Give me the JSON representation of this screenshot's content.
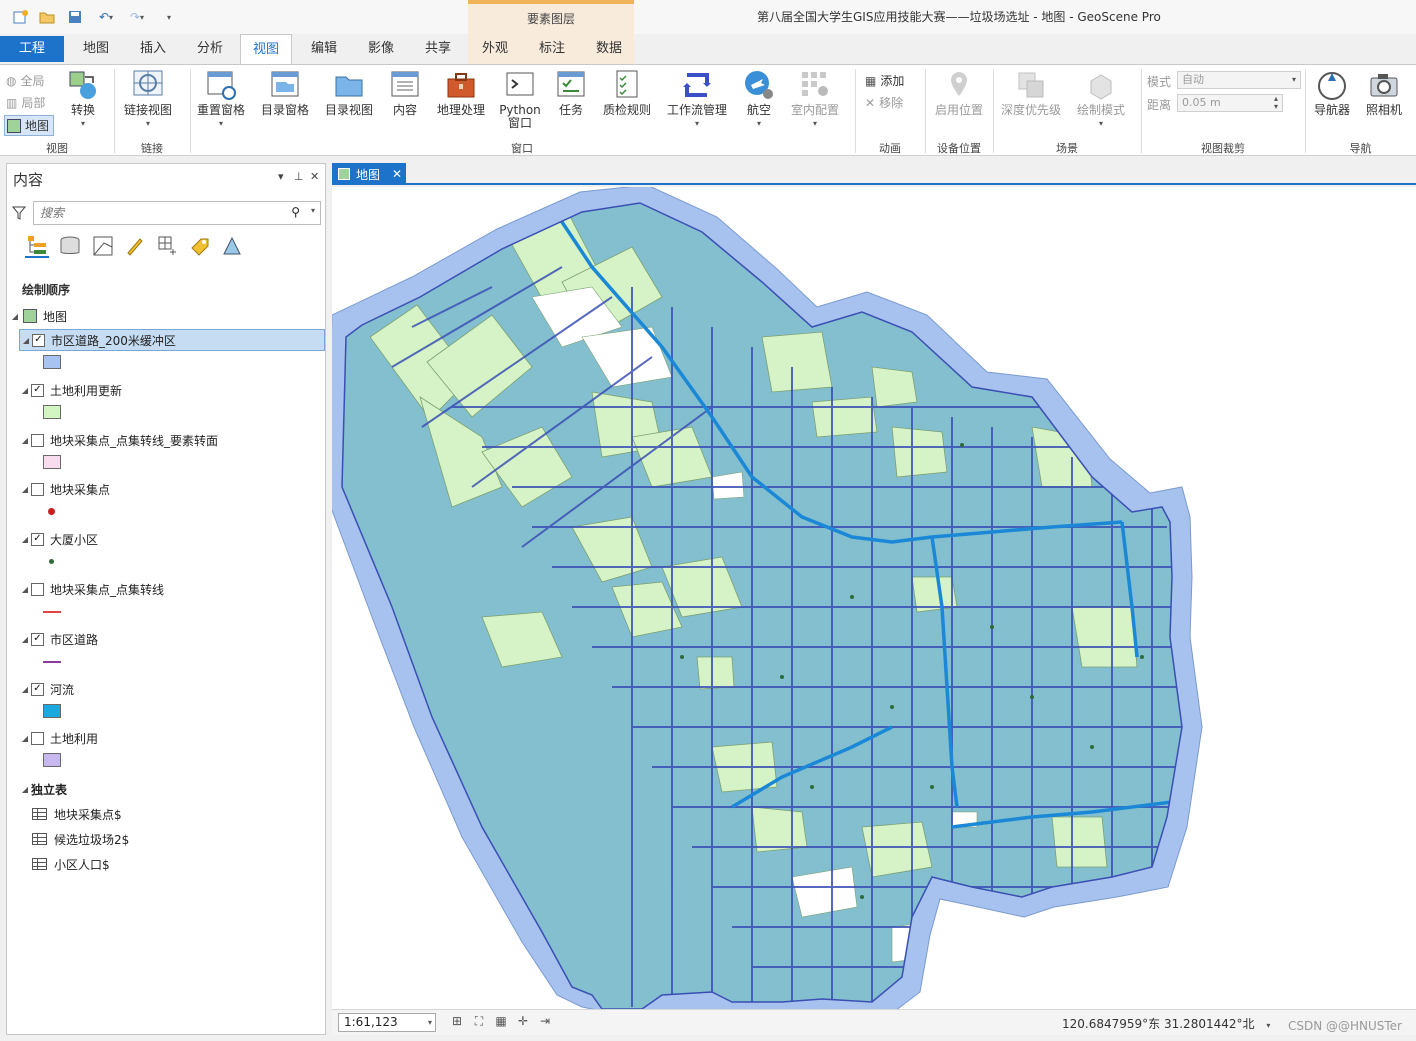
{
  "app": {
    "title": "第八届全国大学生GIS应用技能大赛——垃圾场选址 - 地图 - GeoScene Pro",
    "contextual_group": "要素图层"
  },
  "tabs": [
    {
      "label": "工程"
    },
    {
      "label": "地图"
    },
    {
      "label": "插入"
    },
    {
      "label": "分析"
    },
    {
      "label": "视图"
    },
    {
      "label": "编辑"
    },
    {
      "label": "影像"
    },
    {
      "label": "共享"
    },
    {
      "label": "外观"
    },
    {
      "label": "标注"
    },
    {
      "label": "数据"
    }
  ],
  "ribbon": {
    "view_small": [
      "全局",
      "局部",
      "地图"
    ],
    "convert": "转换",
    "link_views": "链接视图",
    "reset_panes": "重置窗格",
    "catalog_pane": "目录窗格",
    "catalog_view": "目录视图",
    "contents": "内容",
    "geoprocessing": "地理处理",
    "python": "Python\n窗口",
    "tasks": "任务",
    "data_reviewer": "质检规则",
    "workflow": "工作流管理",
    "aviation": "航空",
    "indoors": "室内配置",
    "add": "添加",
    "remove": "移除",
    "device_location": "启用位置",
    "depth_priority": "深度优先级",
    "draw_mode": "绘制模式",
    "mode_label": "模式",
    "mode_value": "自动",
    "distance_label": "距离",
    "distance_value": "0.05 m",
    "navigator": "导航器",
    "camera": "照相机",
    "groups": {
      "view": "视图",
      "link": "链接",
      "windows": "窗口",
      "animation": "动画",
      "device_location": "设备位置",
      "scene": "场景",
      "view_clipping": "视图裁剪",
      "navigate": "导航"
    }
  },
  "contents": {
    "title": "内容",
    "search_placeholder": "搜索",
    "drawing_order": "绘制顺序",
    "map_name": "地图",
    "layers": [
      {
        "name": "市区道路_200米缓冲区",
        "checked": true,
        "swatch": "#a9c3f0",
        "swatch_type": "fill",
        "selected": true
      },
      {
        "name": "土地利用更新",
        "checked": true,
        "swatch": "#d3f5c4",
        "swatch_type": "fill"
      },
      {
        "name": "地块采集点_点集转线_要素转面",
        "checked": false,
        "swatch": "#fadcef",
        "swatch_type": "fill"
      },
      {
        "name": "地块采集点",
        "checked": false,
        "swatch": "#c81e1e",
        "swatch_type": "point"
      },
      {
        "name": "大厦小区",
        "checked": true,
        "swatch": "#2e6b3a",
        "swatch_type": "point-small"
      },
      {
        "name": "地块采集点_点集转线",
        "checked": false,
        "swatch": "#e04444",
        "swatch_type": "line"
      },
      {
        "name": "市区道路",
        "checked": true,
        "swatch": "#8a3c9a",
        "swatch_type": "line"
      },
      {
        "name": "河流",
        "checked": true,
        "swatch": "#1aa8df",
        "swatch_type": "fill"
      },
      {
        "name": "土地利用",
        "checked": false,
        "swatch": "#c8b8f0",
        "swatch_type": "fill"
      }
    ],
    "standalone_header": "独立表",
    "tables": [
      "地块采集点$",
      "候选垃圾场2$",
      "小区人口$"
    ]
  },
  "map": {
    "tab_label": "地图",
    "scale": "1:61,123",
    "coordinates": "120.6847959°东 31.2801442°北"
  },
  "watermark": "CSDN @@HNUSTer"
}
